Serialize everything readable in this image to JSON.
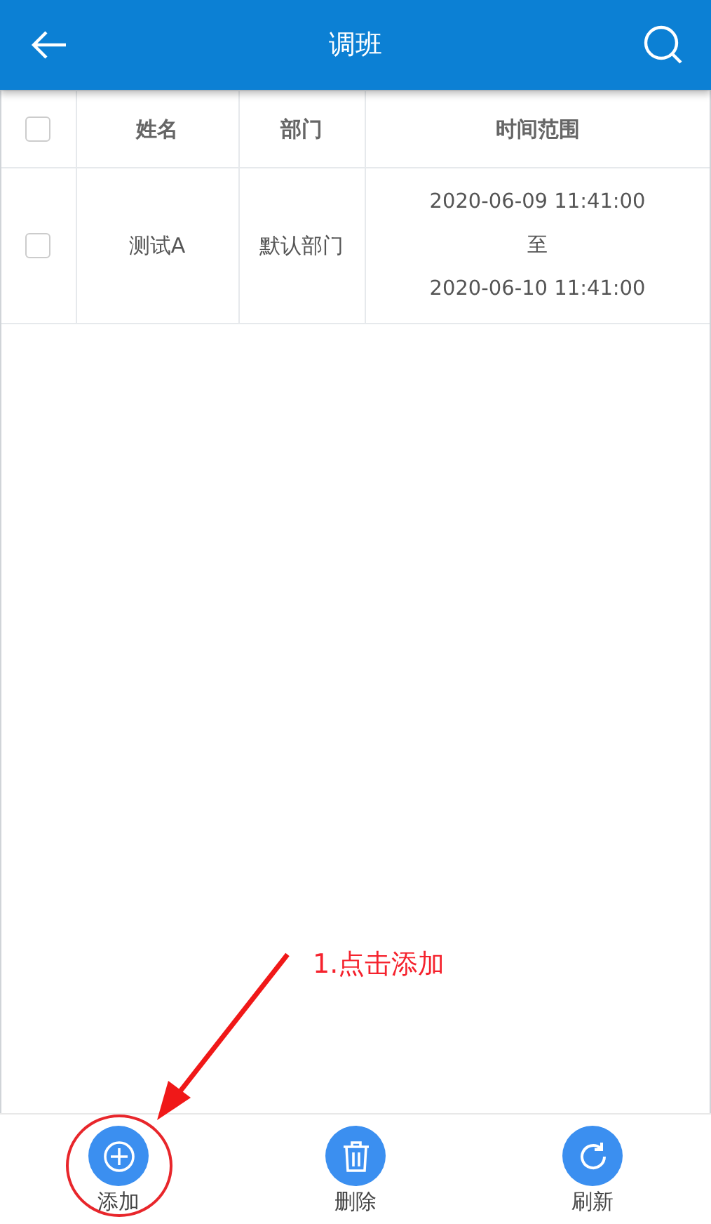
{
  "header": {
    "title": "调班"
  },
  "table": {
    "select_all_checked": false,
    "columns": [
      "姓名",
      "部门",
      "时间范围"
    ],
    "rows": [
      {
        "checked": false,
        "name": "测试A",
        "department": "默认部门",
        "time_from": "2020-06-09 11:41:00",
        "separator": "至",
        "time_to": "2020-06-10 11:41:00"
      }
    ]
  },
  "toolbar": [
    {
      "kind": "add",
      "label": "添加"
    },
    {
      "kind": "delete",
      "label": "删除"
    },
    {
      "kind": "refresh",
      "label": "刷新"
    }
  ],
  "annotation": {
    "text": "1.点击添加"
  }
}
